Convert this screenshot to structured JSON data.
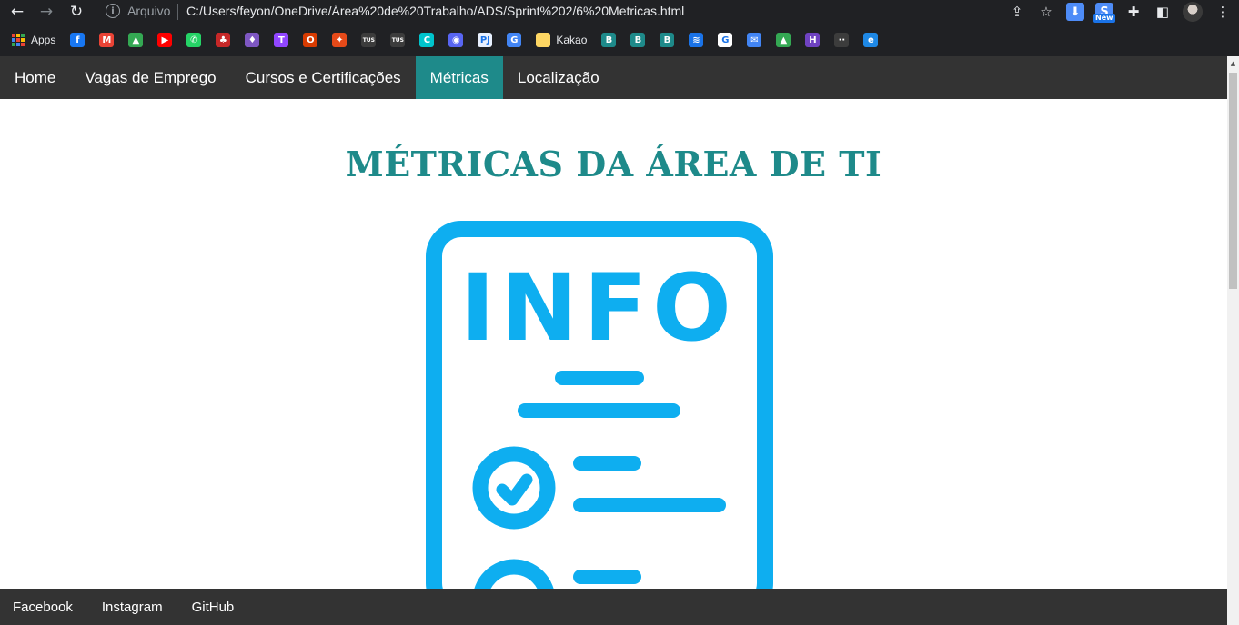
{
  "browser": {
    "security_label": "Arquivo",
    "url": "C:/Users/feyon/OneDrive/Área%20de%20Trabalho/ADS/Sprint%202/6%20Metricas.html",
    "new_badge": "New",
    "bookmarks": [
      {
        "label": "Apps",
        "icon": "apps-grid-icon"
      },
      {
        "label": "",
        "icon": "facebook-icon",
        "color": "#1877f2",
        "glyph": "f"
      },
      {
        "label": "",
        "icon": "gmail-icon",
        "color": "#ea4335",
        "glyph": "M"
      },
      {
        "label": "",
        "icon": "drive-icon",
        "color": "#34a853",
        "glyph": "▲"
      },
      {
        "label": "",
        "icon": "youtube-music-icon",
        "color": "#ff0000",
        "glyph": "▶"
      },
      {
        "label": "",
        "icon": "whatsapp-icon",
        "color": "#25d366",
        "glyph": "✆"
      },
      {
        "label": "",
        "icon": "bookmark-red-icon",
        "color": "#c62828",
        "glyph": "♣"
      },
      {
        "label": "",
        "icon": "bookmark-purple-icon",
        "color": "#7e57c2",
        "glyph": "♦"
      },
      {
        "label": "",
        "icon": "twitch-icon",
        "color": "#9146ff",
        "glyph": "T"
      },
      {
        "label": "",
        "icon": "office-icon",
        "color": "#d83b01",
        "glyph": "O"
      },
      {
        "label": "",
        "icon": "bookmark-orange-icon",
        "color": "#e64a19",
        "glyph": "✦"
      },
      {
        "label": "",
        "icon": "bookmark-tus-icon",
        "color": "#3c3c3c",
        "glyph": "TUS"
      },
      {
        "label": "",
        "icon": "bookmark-tus2-icon",
        "color": "#3c3c3c",
        "glyph": "TUS"
      },
      {
        "label": "",
        "icon": "canva-icon",
        "color": "#00c4cc",
        "glyph": "C"
      },
      {
        "label": "",
        "icon": "discord-icon",
        "color": "#5865f2",
        "glyph": "◉"
      },
      {
        "label": "",
        "icon": "pj-icon",
        "color": "#e8f0fe",
        "glyph": "PJ"
      },
      {
        "label": "",
        "icon": "translate-icon",
        "color": "#4285f4",
        "glyph": "G"
      },
      {
        "label": "Kakao",
        "icon": "folder-icon",
        "color": "#fdd663",
        "glyph": ""
      },
      {
        "label": "",
        "icon": "b-icon-1",
        "color": "#1e8a8a",
        "glyph": "B"
      },
      {
        "label": "",
        "icon": "b-icon-2",
        "color": "#1e8a8a",
        "glyph": "B"
      },
      {
        "label": "",
        "icon": "b-icon-3",
        "color": "#1e8a8a",
        "glyph": "B"
      },
      {
        "label": "",
        "icon": "layers-icon",
        "color": "#1a73e8",
        "glyph": "≋"
      },
      {
        "label": "",
        "icon": "google-icon",
        "color": "#ffffff",
        "glyph": "G"
      },
      {
        "label": "",
        "icon": "chat-icon",
        "color": "#4285f4",
        "glyph": "✉"
      },
      {
        "label": "",
        "icon": "drive2-icon",
        "color": "#34a853",
        "glyph": "▲"
      },
      {
        "label": "",
        "icon": "h-icon",
        "color": "#6f42c1",
        "glyph": "H"
      },
      {
        "label": "",
        "icon": "bookmark-dark-icon",
        "color": "#3c3c3c",
        "glyph": "··"
      },
      {
        "label": "",
        "icon": "ie-icon",
        "color": "#1e88e5",
        "glyph": "e"
      }
    ]
  },
  "nav": {
    "items": [
      {
        "label": "Home"
      },
      {
        "label": "Vagas de Emprego"
      },
      {
        "label": "Cursos e Certificações"
      },
      {
        "label": "Métricas",
        "active": true
      },
      {
        "label": "Localização"
      }
    ]
  },
  "main": {
    "title": "MÉTRICAS DA ÁREA DE TI",
    "image_text": "INFO"
  },
  "footer": {
    "links": [
      {
        "label": "Facebook"
      },
      {
        "label": "Instagram"
      },
      {
        "label": "GitHub"
      }
    ]
  },
  "colors": {
    "accent": "#1e8a8a",
    "nav_bg": "#333333",
    "info_blue": "#0eaef0"
  }
}
